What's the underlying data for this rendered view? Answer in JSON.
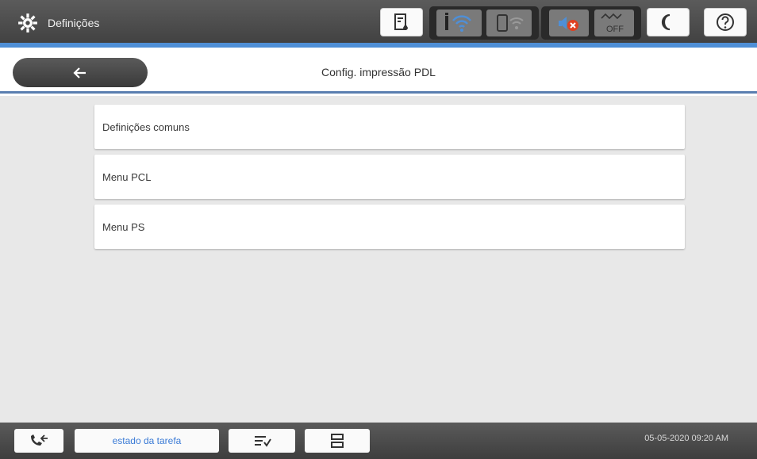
{
  "topbar": {
    "title": "Definições",
    "icons": [
      "gear-icon",
      "ink-levels-icon",
      "wifi-info-icon",
      "wifi-direct-icon",
      "fax-error-icon",
      "power-off-icon",
      "sleep-moon-icon",
      "help-icon"
    ],
    "status_off_label": "OFF"
  },
  "header": {
    "back_icon": "arrow-left-icon",
    "page_title": "Config. impressão PDL"
  },
  "main": {
    "items": [
      {
        "label": "Definições comuns"
      },
      {
        "label": "Menu PCL"
      },
      {
        "label": "Menu PS"
      }
    ]
  },
  "bottombar": {
    "job_status_label": "estado da tarefa",
    "datetime": "05-05-2020 09:20 AM",
    "icons": [
      "fax-call-icon",
      "stop-job-icon",
      "copies-icon"
    ]
  },
  "colors": {
    "accent_blue": "#4f8fd6",
    "link_blue": "#3b7bd6",
    "bar_gray": "#4a4a4a"
  }
}
